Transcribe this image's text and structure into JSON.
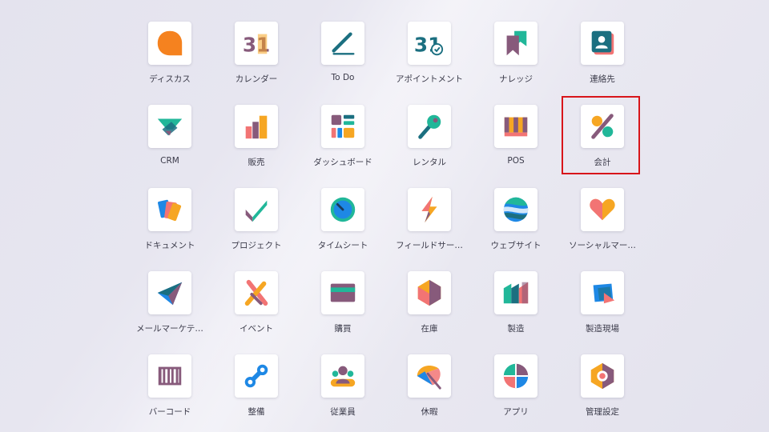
{
  "apps": [
    {
      "label": "ディスカス",
      "icon": "discuss-icon"
    },
    {
      "label": "カレンダー",
      "icon": "calendar-icon",
      "icon_text": "31"
    },
    {
      "label": "To Do",
      "icon": "todo-icon"
    },
    {
      "label": "アポイントメント",
      "icon": "appointment-icon",
      "icon_text": "31"
    },
    {
      "label": "ナレッジ",
      "icon": "knowledge-icon"
    },
    {
      "label": "連絡先",
      "icon": "contacts-icon"
    },
    {
      "label": "CRM",
      "icon": "crm-icon"
    },
    {
      "label": "販売",
      "icon": "sales-icon"
    },
    {
      "label": "ダッシュボード",
      "icon": "dashboard-icon"
    },
    {
      "label": "レンタル",
      "icon": "rental-icon"
    },
    {
      "label": "POS",
      "icon": "pos-icon"
    },
    {
      "label": "会計",
      "icon": "accounting-icon"
    },
    {
      "label": "ドキュメント",
      "icon": "documents-icon"
    },
    {
      "label": "プロジェクト",
      "icon": "project-icon"
    },
    {
      "label": "タイムシート",
      "icon": "timesheet-icon"
    },
    {
      "label": "フィールドサー…",
      "icon": "field-service-icon"
    },
    {
      "label": "ウェブサイト",
      "icon": "website-icon"
    },
    {
      "label": "ソーシャルマー…",
      "icon": "social-marketing-icon"
    },
    {
      "label": "メールマーケテ…",
      "icon": "email-marketing-icon"
    },
    {
      "label": "イベント",
      "icon": "events-icon"
    },
    {
      "label": "購買",
      "icon": "purchase-icon"
    },
    {
      "label": "在庫",
      "icon": "inventory-icon"
    },
    {
      "label": "製造",
      "icon": "manufacturing-icon"
    },
    {
      "label": "製造現場",
      "icon": "shop-floor-icon"
    },
    {
      "label": "バーコード",
      "icon": "barcode-icon"
    },
    {
      "label": "整備",
      "icon": "maintenance-icon"
    },
    {
      "label": "従業員",
      "icon": "employees-icon"
    },
    {
      "label": "休暇",
      "icon": "time-off-icon"
    },
    {
      "label": "アプリ",
      "icon": "apps-icon"
    },
    {
      "label": "管理設定",
      "icon": "settings-icon"
    }
  ],
  "highlight": {
    "app": "会計",
    "color": "#d8151a"
  }
}
